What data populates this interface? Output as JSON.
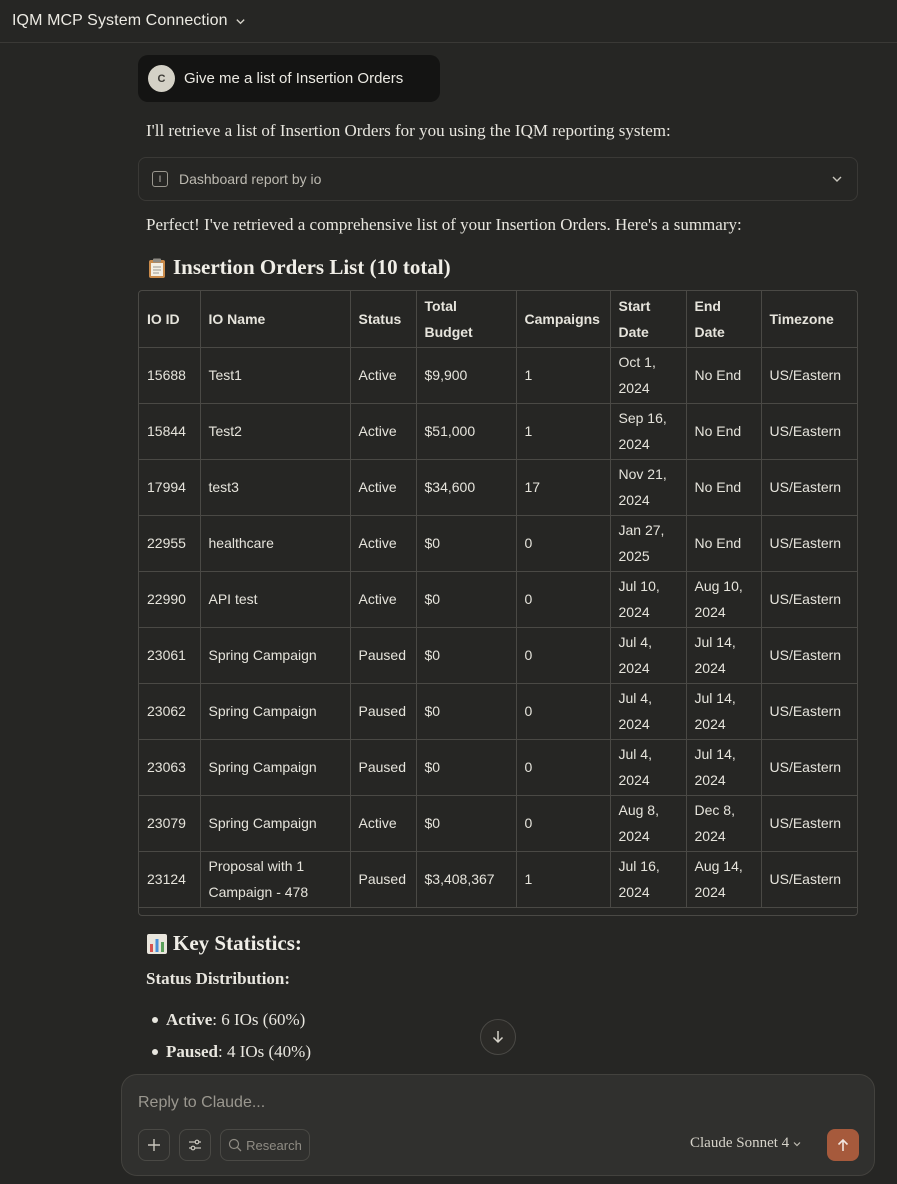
{
  "header": {
    "title": "IQM MCP System Connection"
  },
  "user_message": {
    "avatar_initial": "C",
    "text": "Give me a list of Insertion Orders"
  },
  "assistant": {
    "intro": "I'll retrieve a list of Insertion Orders for you using the IQM reporting system:",
    "tool_call": {
      "icon_letter": "I",
      "label": "Dashboard report by io"
    },
    "summary_intro": "Perfect! I've retrieved a comprehensive list of your Insertion Orders. Here's a summary:",
    "list_heading": "Insertion Orders List (10 total)",
    "table": {
      "headers": [
        "IO ID",
        "IO Name",
        "Status",
        "Total Budget",
        "Campaigns",
        "Start Date",
        "End Date",
        "Timezone"
      ],
      "rows": [
        [
          "15688",
          "Test1",
          "Active",
          "$9,900",
          "1",
          "Oct 1, 2024",
          "No End",
          "US/Eastern"
        ],
        [
          "15844",
          "Test2",
          "Active",
          "$51,000",
          "1",
          "Sep 16, 2024",
          "No End",
          "US/Eastern"
        ],
        [
          "17994",
          "test3",
          "Active",
          "$34,600",
          "17",
          "Nov 21, 2024",
          "No End",
          "US/Eastern"
        ],
        [
          "22955",
          "healthcare",
          "Active",
          "$0",
          "0",
          "Jan 27, 2025",
          "No End",
          "US/Eastern"
        ],
        [
          "22990",
          "API test",
          "Active",
          "$0",
          "0",
          "Jul 10, 2024",
          "Aug 10, 2024",
          "US/Eastern"
        ],
        [
          "23061",
          "Spring Campaign",
          "Paused",
          "$0",
          "0",
          "Jul 4, 2024",
          "Jul 14, 2024",
          "US/Eastern"
        ],
        [
          "23062",
          "Spring Campaign",
          "Paused",
          "$0",
          "0",
          "Jul 4, 2024",
          "Jul 14, 2024",
          "US/Eastern"
        ],
        [
          "23063",
          "Spring Campaign",
          "Paused",
          "$0",
          "0",
          "Jul 4, 2024",
          "Jul 14, 2024",
          "US/Eastern"
        ],
        [
          "23079",
          "Spring Campaign",
          "Active",
          "$0",
          "0",
          "Aug 8, 2024",
          "Dec 8, 2024",
          "US/Eastern"
        ],
        [
          "23124",
          "Proposal with 1 Campaign - 478",
          "Paused",
          "$3,408,367",
          "1",
          "Jul 16, 2024",
          "Aug 14, 2024",
          "US/Eastern"
        ]
      ]
    },
    "stats_heading": "Key Statistics:",
    "status_distribution_label": "Status Distribution:",
    "bullets": [
      {
        "label": "Active",
        "text": ": 6 IOs (60%)"
      },
      {
        "label": "Paused",
        "text": ": 4 IOs (40%)"
      }
    ]
  },
  "composer": {
    "placeholder": "Reply to Claude...",
    "research_label": "Research",
    "model_label": "Claude Sonnet 4"
  },
  "colors": {
    "send_button": "#a65a3c",
    "background": "#262624",
    "composer": "#30302e"
  }
}
